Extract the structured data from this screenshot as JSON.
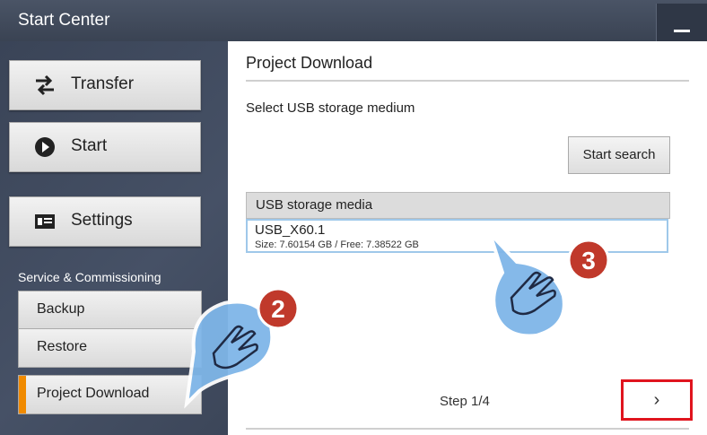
{
  "window": {
    "title": "Start Center"
  },
  "sidebar": {
    "items": [
      {
        "label": "Transfer",
        "icon": "transfer-icon"
      },
      {
        "label": "Start",
        "icon": "play-icon"
      },
      {
        "label": "Settings",
        "icon": "settings-icon"
      }
    ],
    "section_label": "Service & Commissioning",
    "sub_items": [
      {
        "label": "Backup"
      },
      {
        "label": "Restore"
      },
      {
        "label": "Project Download",
        "active": true
      }
    ]
  },
  "main": {
    "title": "Project Download",
    "subtitle": "Select USB storage medium",
    "search_button": "Start search",
    "list": {
      "header": "USB storage media",
      "items": [
        {
          "name": "USB_X60.1",
          "details": "Size: 7.60154 GB / Free: 7.38522 GB"
        }
      ]
    },
    "step": "Step 1/4",
    "next_label": "›"
  },
  "callouts": [
    {
      "number": "2",
      "target": "project-download"
    },
    {
      "number": "3",
      "target": "usb-item"
    }
  ],
  "colors": {
    "accent": "#f08a00",
    "highlight": "#e0141e",
    "badge": "#c0392b",
    "bubble": "#7fb6e8"
  }
}
